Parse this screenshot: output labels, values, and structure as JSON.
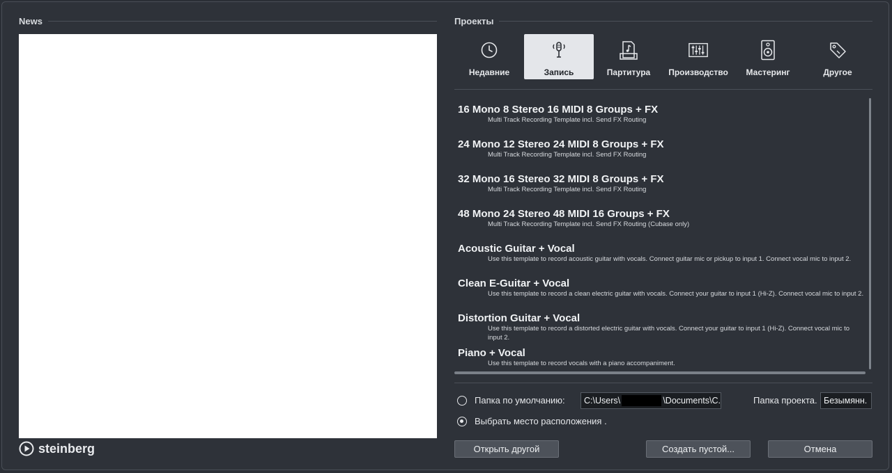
{
  "news": {
    "title": "News"
  },
  "logo": {
    "text": "steinberg"
  },
  "projects": {
    "title": "Проекты",
    "categories": [
      {
        "label": "Недавние",
        "icon": "clock-icon",
        "active": false
      },
      {
        "label": "Запись",
        "icon": "microphone-icon",
        "active": true
      },
      {
        "label": "Партитура",
        "icon": "score-icon",
        "active": false
      },
      {
        "label": "Производство",
        "icon": "mixer-icon",
        "active": false
      },
      {
        "label": "Мастеринг",
        "icon": "speaker-icon",
        "active": false
      },
      {
        "label": "Другое",
        "icon": "tag-icon",
        "active": false
      }
    ],
    "templates": [
      {
        "name": "16 Mono 8 Stereo 16 MIDI 8 Groups + FX",
        "desc": "Multi Track Recording Template incl. Send FX Routing"
      },
      {
        "name": "24 Mono 12 Stereo 24 MIDI 8 Groups + FX",
        "desc": "Multi Track Recording Template incl. Send FX Routing"
      },
      {
        "name": "32 Mono 16 Stereo 32 MIDI 8 Groups + FX",
        "desc": "Multi Track Recording Template incl. Send FX Routing"
      },
      {
        "name": "48 Mono 24 Stereo 48 MIDI 16 Groups + FX",
        "desc": "Multi Track Recording Template incl. Send FX Routing (Cubase only)"
      },
      {
        "name": "Acoustic Guitar + Vocal",
        "desc": "Use this template to record acoustic guitar with vocals. Connect guitar mic or pickup to input  1. Connect vocal mic to input 2."
      },
      {
        "name": "Clean E-Guitar + Vocal",
        "desc": "Use this template to record a clean electric guitar with vocals. Connect your guitar to input  1 (Hi-Z). Connect vocal mic to input 2."
      },
      {
        "name": "Distortion Guitar + Vocal",
        "desc": "Use this template to record a distorted electric guitar with vocals. Connect your guitar to input  1 (Hi-Z). Connect vocal mic to input 2."
      },
      {
        "name": "Piano + Vocal",
        "desc": "Use this template to record vocals with a piano accompaniment."
      }
    ]
  },
  "location": {
    "default_folder_label": "Папка по умолчанию:",
    "default_folder_path_start": "C:\\Users\\",
    "default_folder_path_end": "\\Documents\\C.",
    "choose_location_label": "Выбрать место расположения .",
    "project_folder_label": "Папка проекта.",
    "project_folder_value": "Безымянн.",
    "selected_option": "choose_location"
  },
  "buttons": {
    "open_other": "Открыть другой",
    "create_empty": "Создать пустой...",
    "cancel": "Отмена"
  }
}
